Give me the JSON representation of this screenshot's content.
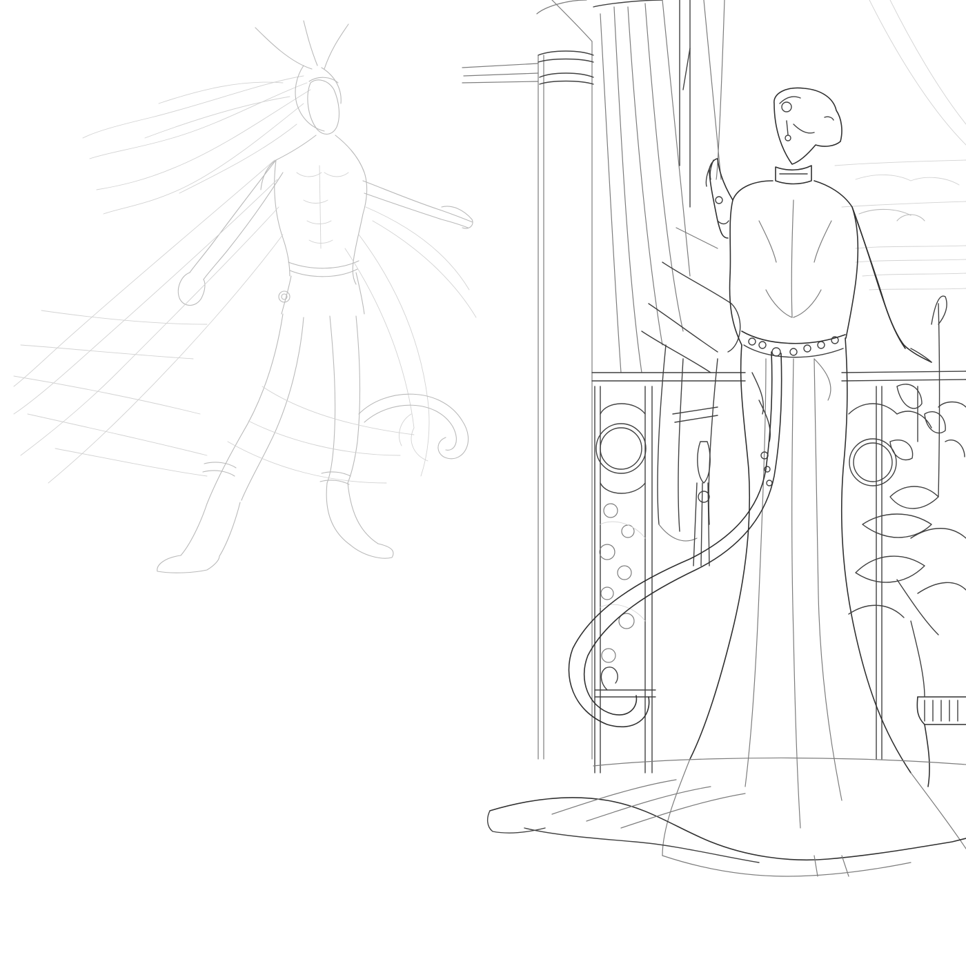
{
  "artwork": {
    "style": "pencil-sketch",
    "paper_color": "#ffffff",
    "line_colors": {
      "light": "#b9b9b9",
      "faint": "#d2d2d2",
      "mid": "#7b7b7b",
      "dark": "#3f3f3f"
    }
  }
}
